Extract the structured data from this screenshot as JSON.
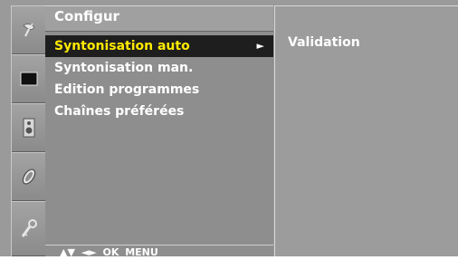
{
  "menu": {
    "title": "Configur",
    "items": [
      {
        "label": "Syntonisation auto",
        "selected": true,
        "arrow": "►"
      },
      {
        "label": "Syntonisation man.",
        "selected": false
      },
      {
        "label": "Edition programmes",
        "selected": false
      },
      {
        "label": "Chaînes préférées",
        "selected": false
      }
    ],
    "footer": "▲▼ ◄► OK MENU"
  },
  "submenu": {
    "items": [
      {
        "label": "Validation"
      }
    ]
  },
  "sidebar": {
    "icons": [
      "antenna-icon",
      "picture-icon",
      "speaker-icon",
      "time-icon",
      "option-key-icon"
    ],
    "active": "antenna-icon"
  },
  "colors": {
    "selected_bg": "#1e1e1e",
    "selected_text": "#ffea00",
    "text": "#ffffff",
    "panel": "#8e8e8e"
  }
}
